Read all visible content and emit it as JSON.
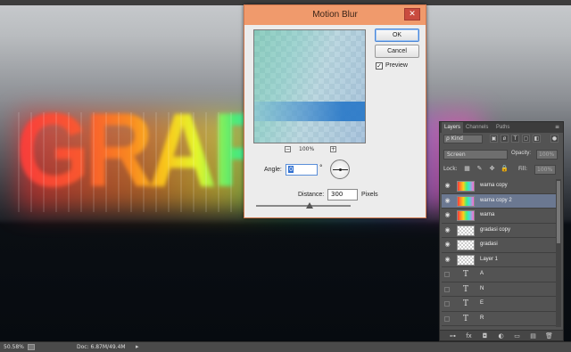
{
  "canvas": {
    "art_text": "GRAFFIT"
  },
  "dialog": {
    "title": "Motion Blur",
    "close_label": "✕",
    "ok_label": "OK",
    "cancel_label": "Cancel",
    "preview_label": "Preview",
    "preview_checked": true,
    "preview_check_glyph": "✓",
    "zoom_out_label": "−",
    "zoom_level": "100%",
    "zoom_in_label": "+",
    "angle_label": "Angle:",
    "angle_value": "0",
    "angle_unit": "°",
    "distance_label": "Distance:",
    "distance_value": "300",
    "distance_unit": "Pixels",
    "accent_color": "#f09a6c"
  },
  "layers_panel": {
    "tabs": [
      "Layers",
      "Channels",
      "Paths"
    ],
    "menu_icon": "≡",
    "filter_kind": "ρ Kind",
    "filter_icons": [
      "▣",
      "ø",
      "T",
      "▢",
      "◧",
      "●"
    ],
    "blend_mode": "Screen",
    "opacity_label": "Opacity:",
    "opacity_value": "100%",
    "lock_label": "Lock:",
    "lock_icons": [
      "▦",
      "✎",
      "✥",
      "🔒"
    ],
    "fill_label": "Fill:",
    "fill_value": "100%",
    "selected_color": "#6b7891",
    "layers": [
      {
        "name": "warna copy",
        "visible": true,
        "thumb": "color",
        "selected": false
      },
      {
        "name": "warna copy 2",
        "visible": true,
        "thumb": "color",
        "selected": true
      },
      {
        "name": "warna",
        "visible": true,
        "thumb": "color",
        "selected": false
      },
      {
        "name": "gradasi copy",
        "visible": true,
        "thumb": "transparent",
        "selected": false
      },
      {
        "name": "gradasi",
        "visible": true,
        "thumb": "transparent",
        "selected": false
      },
      {
        "name": "Layer 1",
        "visible": true,
        "thumb": "transparent",
        "selected": false
      },
      {
        "name": "A",
        "visible": false,
        "thumb": "text",
        "selected": false
      },
      {
        "name": "N",
        "visible": false,
        "thumb": "text",
        "selected": false
      },
      {
        "name": "E",
        "visible": false,
        "thumb": "text",
        "selected": false
      },
      {
        "name": "R",
        "visible": false,
        "thumb": "text",
        "selected": false
      }
    ],
    "text_thumb_glyph": "T",
    "eye_glyph": "◉",
    "footer_icons": [
      "⊶",
      "fx",
      "◘",
      "◐",
      "▭",
      "▤",
      "🗑"
    ]
  },
  "status_bar": {
    "zoom": "50.58%",
    "doc_size": "Doc: 6.87M/49.4M",
    "arrow": "▸"
  }
}
